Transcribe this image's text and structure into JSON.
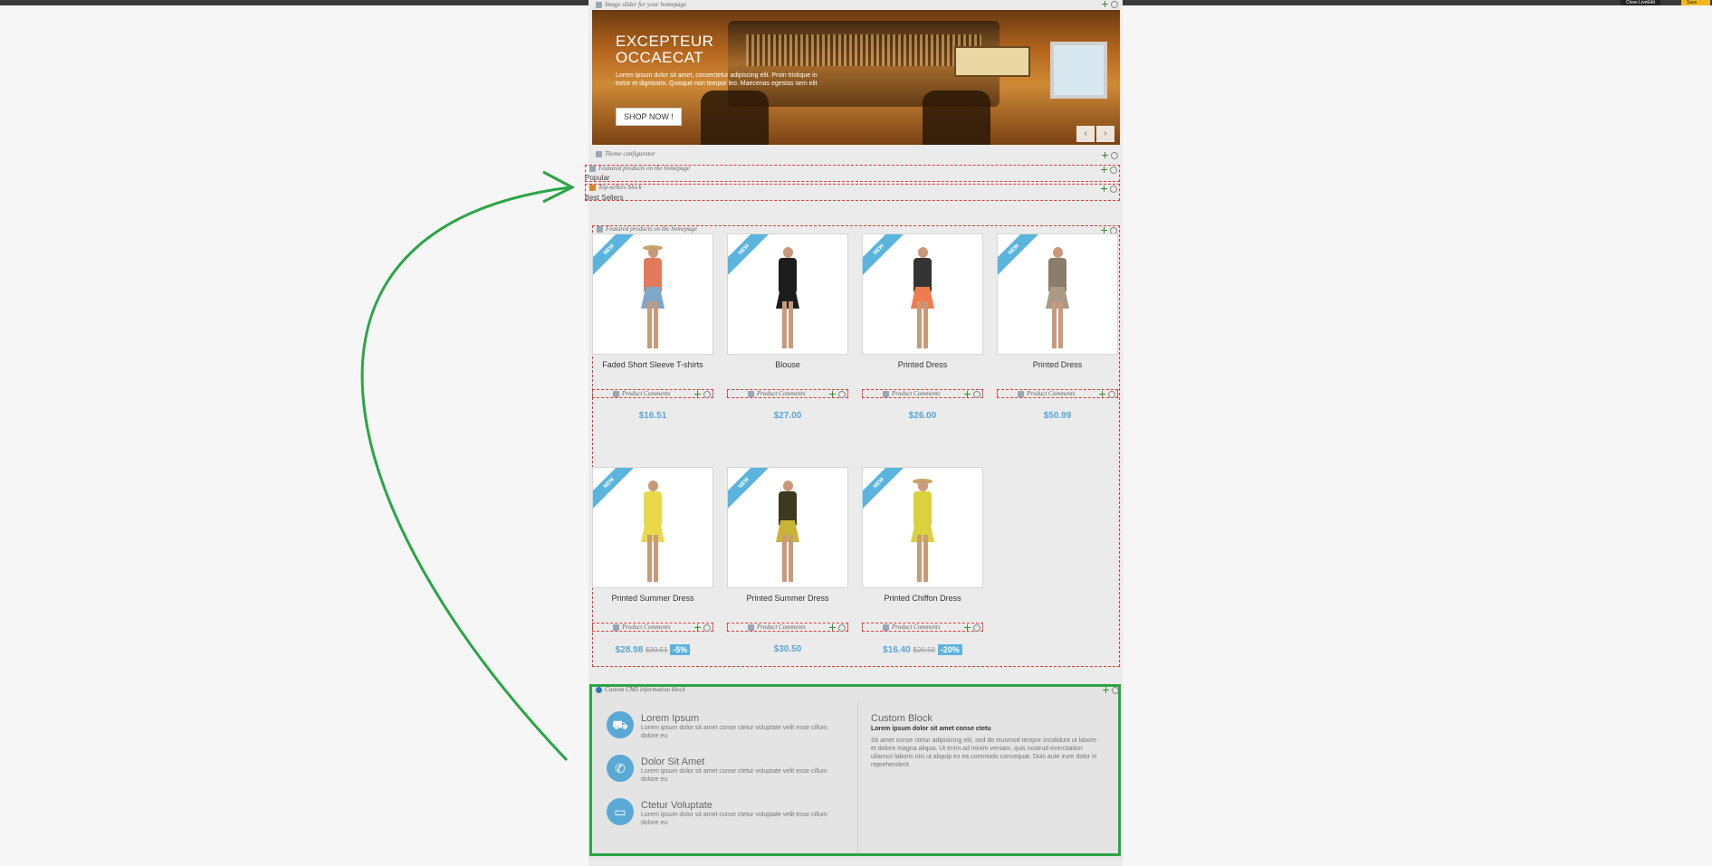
{
  "top_bar": {
    "button_label": "Close LiveEdit",
    "save_label": "Save"
  },
  "modules": {
    "slider": "Image slider for your homepage",
    "theme": "Theme configurator",
    "featured_top": "Featured products on the homepage",
    "topsellers": "Top-sellers block",
    "featured_main": "Featured products on the homepage",
    "comments": "Product Comments",
    "cms": "Custom CMS information block"
  },
  "slider": {
    "title_line1": "EXCEPTEUR",
    "title_line2": "OCCAECAT",
    "text": "Lorem ipsum dolor sit amet, consectetur adipiscing elit. Proin tristique in tortor et dignissim. Quisque non tempor leo. Maecenas egestas sem elit",
    "button": "SHOP NOW !"
  },
  "tabs": {
    "popular": "Popular",
    "best_sellers": "Best Sellers"
  },
  "badge": "NEW",
  "products": [
    {
      "name": "Faded Short Sleeve T-shirts",
      "price": "$16.51",
      "old": "",
      "discount": "",
      "top": "#e07a5a",
      "bottom": "#7fa7c9",
      "hat": true
    },
    {
      "name": "Blouse",
      "price": "$27.00",
      "old": "",
      "discount": "",
      "top": "#1c1c1c",
      "bottom": "#1c1c1c",
      "hat": false
    },
    {
      "name": "Printed Dress",
      "price": "$26.00",
      "old": "",
      "discount": "",
      "top": "#333",
      "bottom": "#f07b4c",
      "hat": false
    },
    {
      "name": "Printed Dress",
      "price": "$50.99",
      "old": "",
      "discount": "",
      "top": "#8a7d6a",
      "bottom": "#a99a86",
      "hat": false
    },
    {
      "name": "Printed Summer Dress",
      "price": "$28.98",
      "old": "$30.51",
      "discount": "-5%",
      "top": "#e9d84a",
      "bottom": "#e9d84a",
      "hat": false
    },
    {
      "name": "Printed Summer Dress",
      "price": "$30.50",
      "old": "",
      "discount": "",
      "top": "#3b3a1e",
      "bottom": "#c9b436",
      "hat": false
    },
    {
      "name": "Printed Chiffon Dress",
      "price": "$16.40",
      "old": "$20.50",
      "discount": "-20%",
      "top": "#d9d23c",
      "bottom": "#d9d23c",
      "hat": true
    }
  ],
  "cms": {
    "items": [
      {
        "icon": "truck-icon",
        "glyph": "🚚",
        "title": "Lorem Ipsum",
        "text": "Lorem ipsum dolor sit amet conse ctetur voluptate velit esse cillum dolore eu"
      },
      {
        "icon": "phone-icon",
        "glyph": "✆",
        "title": "Dolor Sit Amet",
        "text": "Lorem ipsum dolor sit amet conse ctetur voluptate velit esse cillum dolore eu"
      },
      {
        "icon": "credit-card-icon",
        "glyph": "▭",
        "title": "Ctetur Voluptate",
        "text": "Lorem ipsum dolor sit amet conse ctetur voluptate velit esse cillum dolore eu"
      }
    ],
    "custom_title": "Custom Block",
    "custom_sub": "Lorem ipsum dolor sit amet conse ctetu",
    "custom_text": "Sit amet conse ctetur adipisicing elit, sed do eiusmod tempor incididunt ut labore et dolore magna aliqua. Ut enim ad minim veniam, quis nostrud exercitation ullamco laboris nisi ut aliquip ex ea commodo consequat. Duis aute irure dolor in reprehenderit."
  },
  "colors": {
    "accent": "#5bb4dd",
    "annotation": "#2aa545",
    "module_border": "#e23b3b"
  }
}
